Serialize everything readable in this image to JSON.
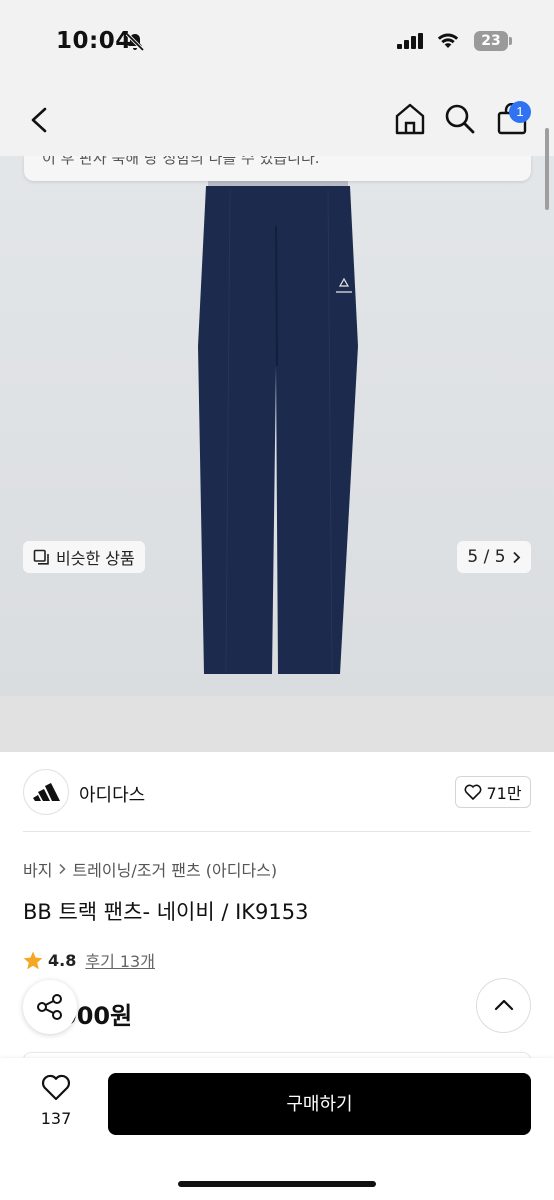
{
  "status_bar": {
    "time": "10:04",
    "battery": "23"
  },
  "nav": {
    "cart_badge": "1"
  },
  "hero": {
    "toast_text": "이 후 판사 북해 랑 정함의 다를 수 있습니다.",
    "similar_label": "비슷한 상품",
    "pager": "5 / 5"
  },
  "brand": {
    "name": "아디다스",
    "likes": "71만"
  },
  "breadcrumb": {
    "first": "바지",
    "second": "트레이닝/조거 팬츠 (아디다스)"
  },
  "product": {
    "title": "BB 트랙 팬츠- 네이비 / IK9153",
    "rating": "4.8",
    "reviews": "후기 13개",
    "price": "000원"
  },
  "bottom": {
    "wish_count": "137",
    "buy_label": "구매하기"
  },
  "colors": {
    "accent_badge": "#2f73f2",
    "pants": "#1c2a4d",
    "star": "#f5a623"
  }
}
